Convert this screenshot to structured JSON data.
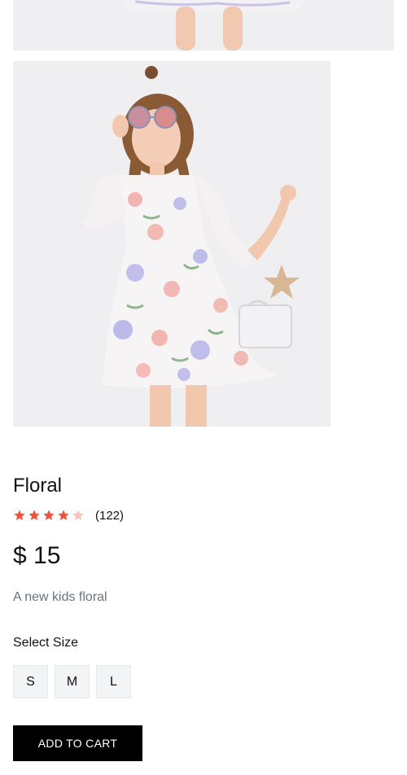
{
  "product": {
    "title": "Floral",
    "rating": 4,
    "rating_max": 5,
    "reviews": "(122)",
    "price": "$ 15",
    "description": "A new kids floral"
  },
  "size_selector": {
    "label": "Select Size",
    "options": [
      "S",
      "M",
      "L"
    ]
  },
  "actions": {
    "add_to_cart": "ADD TO CART"
  },
  "colors": {
    "star_filled": "#f0533a",
    "star_empty": "#f9c3b8",
    "button_bg": "#000000",
    "muted_text": "#6b7280"
  }
}
